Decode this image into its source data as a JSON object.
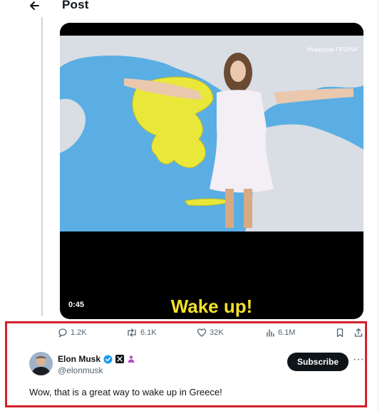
{
  "header": {
    "title": "Post",
    "back_icon": "arrow-left-icon"
  },
  "video": {
    "caption": "Wake up!",
    "duration": "0:45",
    "watermark": "#happyday ΠΡΩΙΝΑ"
  },
  "actions": {
    "replies": "1.2K",
    "reposts": "6.1K",
    "likes": "32K",
    "views": "6.1M",
    "reply_icon": "speech-bubble-icon",
    "repost_icon": "repost-icon",
    "like_icon": "heart-icon",
    "views_icon": "bar-chart-icon",
    "bookmark_icon": "bookmark-icon",
    "share_icon": "share-icon"
  },
  "author": {
    "name": "Elon Musk",
    "handle": "@elonmusk",
    "verified_icon": "verified-badge-icon",
    "affiliate_icon": "x-logo-icon",
    "extra_icon": "person-badge-icon"
  },
  "subscribe_label": "Subscribe",
  "more_label": "···",
  "post_text": "Wow, that is a great way to wake up in Greece!",
  "colors": {
    "highlight": "#d3212c",
    "verified": "#1d9bf0",
    "caption": "#f2e12a",
    "map_sea": "#5aaee4",
    "map_greece": "#e9e83a",
    "map_land": "#d9dde4"
  }
}
